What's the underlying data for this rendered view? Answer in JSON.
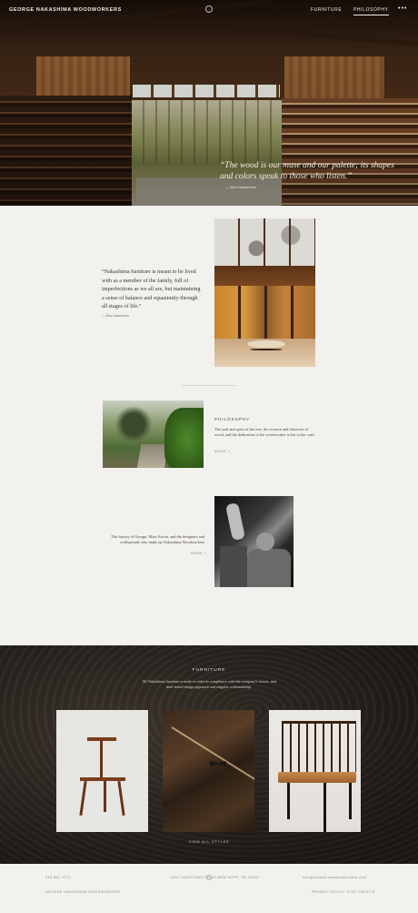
{
  "header": {
    "brand": "GEORGE NAKASHIMA WOODWORKERS",
    "nav": [
      {
        "label": "FURNITURE"
      },
      {
        "label": "PHILOSOPHY"
      }
    ],
    "more_label": "•••"
  },
  "hero": {
    "quote": "“The wood is our muse and our palette; its shapes and colors speak to those who listen.”",
    "attribution": "Mira Nakashima"
  },
  "quote_section": {
    "quote": "“Nakashima furniture is meant to be lived with as a member of the family, full of imperfections as we all are, but maintaining a sense of balance and equanimity through all stages of life.”",
    "attribution": "Mira Nakashima"
  },
  "philosophy": {
    "heading": "PHILOSOPHY",
    "body": "The soul and spirit of the tree, the essence and character of wood, and the dedication of the woodworker to his or her craft.",
    "more_label": "MORE >"
  },
  "history": {
    "body": "The history of George, Mira, Kevin, and the designers and craftspeople who make up Nakashima Woodworkers",
    "more_label": "MORE >"
  },
  "furniture": {
    "heading": "FURNITURE",
    "description": "All Nakashima furniture is made to order in compliance with the company's classic, and time-tested design approach and singular craftsmanship.",
    "view_all_label": "VIEW ALL STYLES"
  },
  "footer": {
    "phone": "215 862 2272",
    "address": "1847 AQUETONG ROAD NEW HOPE, PA 18938",
    "email": "info@nakashimawoodworkers.com",
    "copyright": "GEORGE NAKASHIMA WOODWORKERS",
    "links": [
      "PRIVACY POLICY",
      "SITE CREDITS"
    ]
  }
}
